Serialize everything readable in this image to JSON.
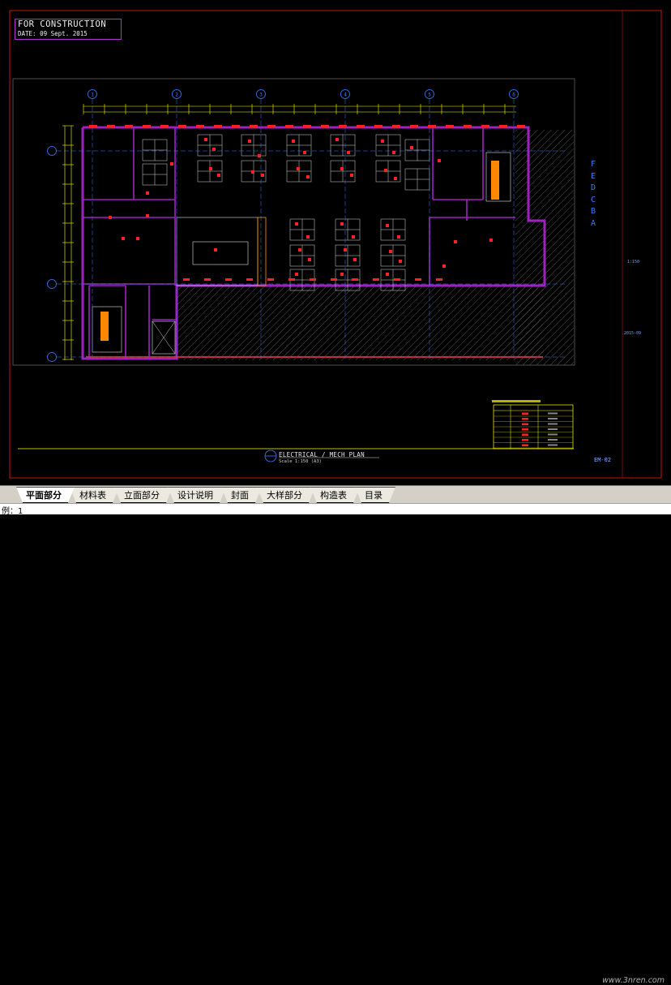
{
  "stamp": {
    "line1": "FOR CONSTRUCTION",
    "line2": "DATE:  09 Sept. 2015"
  },
  "plan": {
    "title": "ELECTRICAL / MECH PLAN",
    "scale": "Scale 1:150 (A3)"
  },
  "drawing_no": "EM-02",
  "grid_letters": [
    "F",
    "E",
    "D",
    "C",
    "B",
    "A"
  ],
  "grid_numbers": [
    "1",
    "2",
    "3",
    "4",
    "5",
    "6"
  ],
  "side_notes": {
    "scale_note": "1:150",
    "date_note": "2015-09"
  },
  "tabs": [
    {
      "label": "平面部分",
      "active": true
    },
    {
      "label": "材料表",
      "active": false
    },
    {
      "label": "立面部分",
      "active": false
    },
    {
      "label": "设计说明",
      "active": false
    },
    {
      "label": "封面",
      "active": false
    },
    {
      "label": "大样部分",
      "active": false
    },
    {
      "label": "构造表",
      "active": false
    },
    {
      "label": "目录",
      "active": false
    }
  ],
  "watermark": "www.3nren.com",
  "command_line": "例：1",
  "colors": {
    "background": "#000000",
    "frame": "#cc1111",
    "wall": "#a020c0",
    "electrical": "#ff2020",
    "grid": "#3a7cff",
    "dimension": "#ffff00"
  }
}
